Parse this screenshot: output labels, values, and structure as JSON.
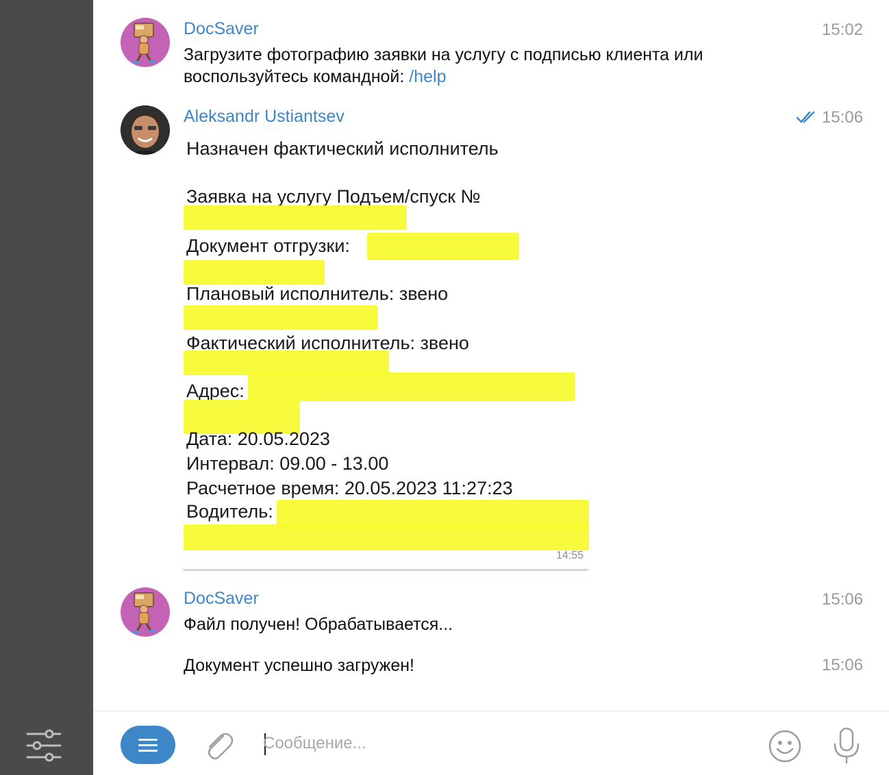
{
  "messages": [
    {
      "sender": "DocSaver",
      "time": "15:02",
      "text_line1": "Загрузите фотографию заявки на услугу с подписью клиента или",
      "text_line2_prefix": "воспользуйтесь командной: ",
      "command_link": "/help"
    },
    {
      "sender": "Aleksandr Ustiantsev",
      "time": "15:06",
      "read_status": "double-check",
      "photo": {
        "lines": [
          "Назначен фактический исполнитель",
          "Заявка на услугу Подъем/спуск №",
          "Документ отгрузки:",
          "Плановый исполнитель: звено",
          "Фактический исполнитель: звено",
          "Адрес:",
          "Дата: 20.05.2023",
          "Интервал: 09.00 - 13.00",
          "Расчетное время: 20.05.2023 11:27:23",
          "Водитель:"
        ],
        "time": "14:55"
      }
    },
    {
      "sender": "DocSaver",
      "time": "15:06",
      "text": "Файл получен! Обрабатывается..."
    },
    {
      "time": "15:06",
      "text": "Документ успешно загружен!"
    }
  ],
  "composer": {
    "placeholder": "Сообщение..."
  },
  "icons": {
    "settings": "sliders-icon",
    "menu": "menu-icon",
    "attach": "paperclip-icon",
    "emoji": "emoji-icon",
    "voice": "microphone-icon"
  },
  "colors": {
    "accent": "#3f86c9",
    "rail": "#4a4a4a",
    "bot_avatar": "#c462b6",
    "redaction": "#f7fa2c",
    "time": "#9a9a9a"
  }
}
